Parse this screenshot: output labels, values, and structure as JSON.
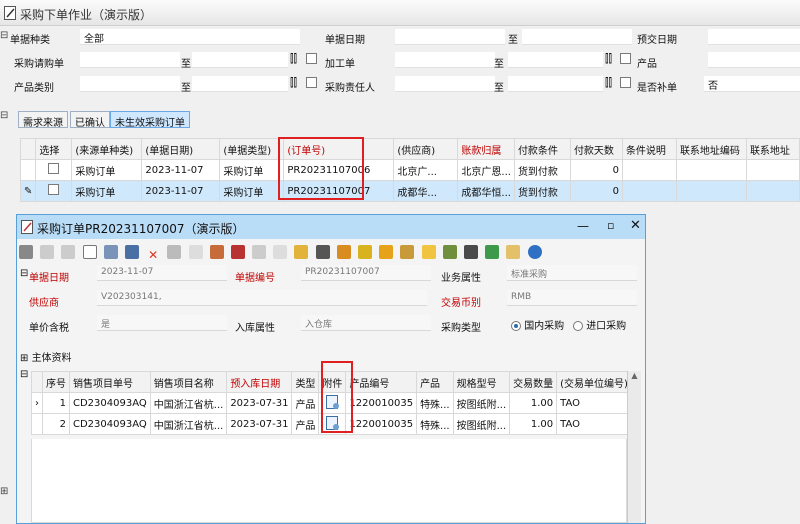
{
  "window": {
    "title": "采购下单作业（演示版）"
  },
  "filters": {
    "doc_type_label": "单据种类",
    "doc_type_value": "全部",
    "doc_date_label": "单据日期",
    "to1": "至",
    "delivery_date_label": "预交日期",
    "purchase_request_label": "采购请购单",
    "to2": "至",
    "process_label": "加工单",
    "to3": "至",
    "product_label": "产品",
    "product_category_label": "产品类别",
    "to4": "至",
    "buyer_label": "采购责任人",
    "to5": "至",
    "supplement_label": "是否补单",
    "supplement_value": "否"
  },
  "tabs": [
    "需求来源",
    "已确认",
    "未生效采购订单"
  ],
  "main_grid": {
    "headers": [
      "选择",
      "(来源单种类)",
      "(单据日期)",
      "(单据类型)",
      "(订单号)",
      "(供应商)",
      "账款归属",
      "付款条件",
      "付款天数",
      "条件说明",
      "联系地址编码",
      "联系地址"
    ],
    "rows": [
      [
        "",
        "采购订单",
        "2023-11-07",
        "采购订单",
        "PR20231107006",
        "北京广...",
        "北京广恩...",
        "货到付款",
        "0",
        "",
        "",
        ""
      ],
      [
        "",
        "采购订单",
        "2023-11-07",
        "采购订单",
        "PR20231107007",
        "成都华...",
        "成都华恒...",
        "货到付款",
        "0",
        "",
        "",
        ""
      ]
    ]
  },
  "dialog": {
    "title": "采购订单PR20231107007（演示版）",
    "doc_date_label": "单据日期",
    "doc_date_value": "2023-11-07",
    "doc_no_label": "单据编号",
    "doc_no_value": "PR20231107007",
    "business_attr_label": "业务属性",
    "business_attr_value": "标准采购",
    "supplier_label": "供应商",
    "supplier_value": "V202303141,",
    "currency_label": "交易币别",
    "currency_value": "RMB",
    "tax_label": "单价含税",
    "tax_value": "是",
    "warehouse_attr_label": "入库属性",
    "warehouse_attr_value": "入仓库",
    "purchase_type_label": "采购类型",
    "radio_domestic": "国内采购",
    "radio_import": "进口采购",
    "main_info_label": "主体资料",
    "grid": {
      "headers": [
        "序号",
        "销售项目单号",
        "销售项目名称",
        "预入库日期",
        "类型",
        "附件",
        "产品编号",
        "产品",
        "规格型号",
        "交易数量",
        "(交易单位编号)"
      ],
      "rows": [
        [
          "1",
          "CD2304093AQ",
          "中国浙江省杭...",
          "2023-07-31",
          "产品",
          "",
          "1220010035",
          "特殊...",
          "按图纸附...",
          "1.00",
          "TAO"
        ],
        [
          "2",
          "CD2304093AQ",
          "中国浙江省杭...",
          "2023-07-31",
          "产品",
          "",
          "1220010035",
          "特殊...",
          "按图纸附...",
          "1.00",
          "TAO"
        ]
      ]
    }
  }
}
